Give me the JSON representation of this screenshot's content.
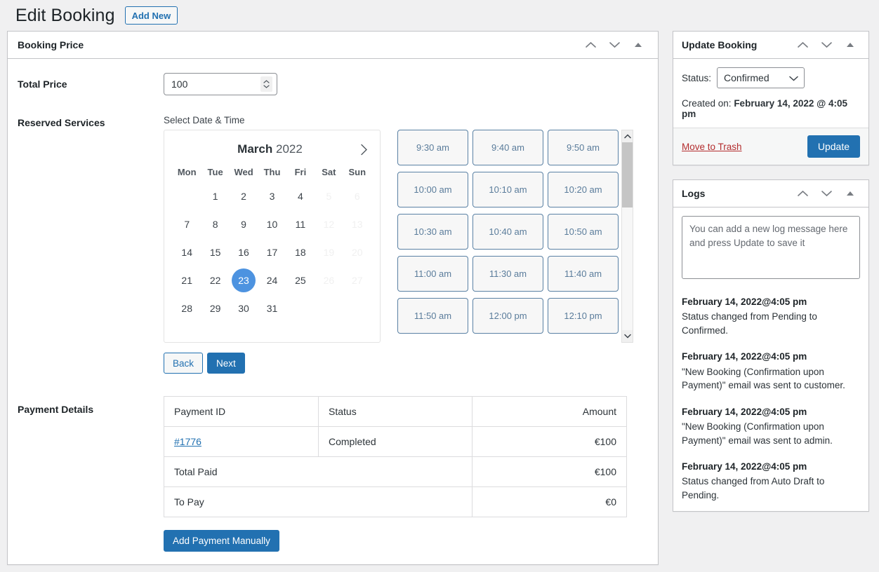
{
  "header": {
    "title": "Edit Booking",
    "add_new_label": "Add New"
  },
  "booking_price_panel": {
    "title": "Booking Price",
    "total_price_label": "Total Price",
    "total_price_value": "100",
    "reserved_services_label": "Reserved Services",
    "select_date_time_label": "Select Date & Time",
    "back_label": "Back",
    "next_label": "Next"
  },
  "calendar": {
    "month": "March",
    "year": "2022",
    "weekdays": [
      "Mon",
      "Tue",
      "Wed",
      "Thu",
      "Fri",
      "Sat",
      "Sun"
    ],
    "selected_day": 23,
    "leading_blanks": 1,
    "days": [
      {
        "n": "1",
        "state": "normal"
      },
      {
        "n": "2",
        "state": "normal"
      },
      {
        "n": "3",
        "state": "normal"
      },
      {
        "n": "4",
        "state": "normal"
      },
      {
        "n": "5",
        "state": "disabled"
      },
      {
        "n": "6",
        "state": "disabled"
      },
      {
        "n": "7",
        "state": "normal"
      },
      {
        "n": "8",
        "state": "normal"
      },
      {
        "n": "9",
        "state": "normal"
      },
      {
        "n": "10",
        "state": "normal"
      },
      {
        "n": "11",
        "state": "normal"
      },
      {
        "n": "12",
        "state": "disabled"
      },
      {
        "n": "13",
        "state": "disabled"
      },
      {
        "n": "14",
        "state": "normal"
      },
      {
        "n": "15",
        "state": "normal"
      },
      {
        "n": "16",
        "state": "normal"
      },
      {
        "n": "17",
        "state": "normal"
      },
      {
        "n": "18",
        "state": "normal"
      },
      {
        "n": "19",
        "state": "disabled"
      },
      {
        "n": "20",
        "state": "disabled"
      },
      {
        "n": "21",
        "state": "normal"
      },
      {
        "n": "22",
        "state": "normal"
      },
      {
        "n": "23",
        "state": "selected"
      },
      {
        "n": "24",
        "state": "normal"
      },
      {
        "n": "25",
        "state": "normal"
      },
      {
        "n": "26",
        "state": "disabled"
      },
      {
        "n": "27",
        "state": "disabled"
      },
      {
        "n": "28",
        "state": "normal"
      },
      {
        "n": "29",
        "state": "normal"
      },
      {
        "n": "30",
        "state": "normal"
      },
      {
        "n": "31",
        "state": "normal"
      }
    ],
    "selected_accent_color": "#4d93e0"
  },
  "time_slots": [
    "9:30 am",
    "9:40 am",
    "9:50 am",
    "10:00 am",
    "10:10 am",
    "10:20 am",
    "10:30 am",
    "10:40 am",
    "10:50 am",
    "11:00 am",
    "11:30 am",
    "11:40 am",
    "11:50 am",
    "12:00 pm",
    "12:10 pm"
  ],
  "payment_details": {
    "label": "Payment Details",
    "columns": [
      "Payment ID",
      "Status",
      "Amount"
    ],
    "rows": [
      {
        "id": "#1776",
        "status": "Completed",
        "amount": "€100"
      }
    ],
    "total_paid_label": "Total Paid",
    "total_paid_amount": "€100",
    "to_pay_label": "To Pay",
    "to_pay_amount": "€0",
    "add_payment_label": "Add Payment Manually"
  },
  "update_booking_panel": {
    "title": "Update Booking",
    "status_label": "Status:",
    "status_value": "Confirmed",
    "status_options": [
      "Confirmed"
    ],
    "created_on_label": "Created on:",
    "created_on_value": "February 14, 2022 @ 4:05 pm",
    "move_to_trash_label": "Move to Trash",
    "update_label": "Update",
    "trash_color": "#b32d2e",
    "primary_color": "#2271b1"
  },
  "logs_panel": {
    "title": "Logs",
    "textarea_placeholder": "You can add a new log message here and press Update to save it",
    "textarea_value": "",
    "entries": [
      {
        "date": "February 14, 2022@4:05 pm",
        "message": "Status changed from Pending to Confirmed."
      },
      {
        "date": "February 14, 2022@4:05 pm",
        "message": "\"New Booking (Confirmation upon Payment)\" email was sent to customer."
      },
      {
        "date": "February 14, 2022@4:05 pm",
        "message": "\"New Booking (Confirmation upon Payment)\" email was sent to admin."
      },
      {
        "date": "February 14, 2022@4:05 pm",
        "message": "Status changed from Auto Draft to Pending."
      }
    ]
  },
  "icons": {
    "move_up": "chevron-up-icon",
    "move_down": "chevron-down-icon",
    "toggle": "triangle-up-icon",
    "calendar_next": "chevron-right-icon",
    "select_caret": "chevron-down-icon",
    "spinner": "number-spinner-icon",
    "scroll_up": "scroll-up-arrow-icon",
    "scroll_down": "scroll-down-arrow-icon"
  }
}
